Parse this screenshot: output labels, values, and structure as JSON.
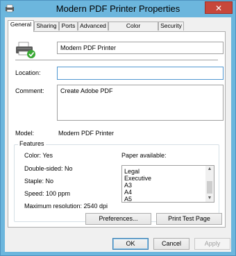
{
  "window": {
    "title": "Modern PDF Printer Properties",
    "close_label": "✕",
    "app_icon": "printer-icon"
  },
  "tabs": [
    {
      "label": "General"
    },
    {
      "label": "Sharing"
    },
    {
      "label": "Ports"
    },
    {
      "label": "Advanced"
    },
    {
      "label": "Color Management"
    },
    {
      "label": "Security"
    }
  ],
  "general": {
    "printer_name": "Modern PDF Printer",
    "location_label": "Location:",
    "location_value": "",
    "comment_label": "Comment:",
    "comment_value": "Create Adobe PDF",
    "model_label": "Model:",
    "model_value": "Modern PDF Printer"
  },
  "features": {
    "title": "Features",
    "color": "Color: Yes",
    "double_sided": "Double-sided: No",
    "staple": "Staple: No",
    "speed": "Speed: 100 ppm",
    "max_resolution": "Maximum resolution: 2540 dpi",
    "paper_label": "Paper available:",
    "paper_items": [
      "Legal",
      "Executive",
      "A3",
      "A4",
      "A5"
    ]
  },
  "buttons": {
    "preferences": "Preferences...",
    "print_test_page": "Print Test Page",
    "ok": "OK",
    "cancel": "Cancel",
    "apply": "Apply"
  },
  "colors": {
    "title_bar": "#6cb6dd",
    "close_button": "#c7473b",
    "focus_border": "#4f96d1"
  }
}
